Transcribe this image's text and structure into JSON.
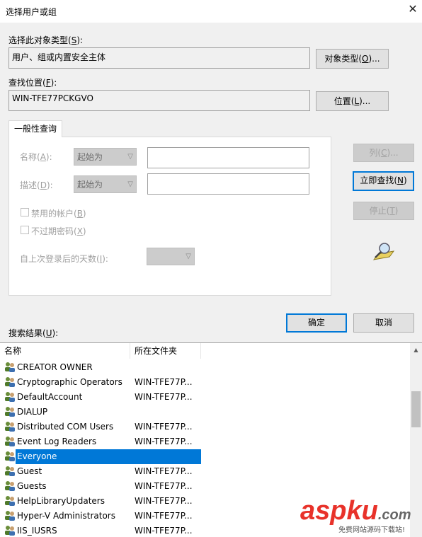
{
  "dialog": {
    "title": "选择用户或组"
  },
  "object_type": {
    "label_pre": "选择此对象类型(",
    "label_key": "S",
    "label_post": "):",
    "value": "用户、组或内置安全主体",
    "button_pre": "对象类型(",
    "button_key": "O",
    "button_post": ")..."
  },
  "location": {
    "label_pre": "查找位置(",
    "label_key": "F",
    "label_post": "):",
    "value": "WIN-TFE77PCKGVO",
    "button_pre": "位置(",
    "button_key": "L",
    "button_post": ")..."
  },
  "tab": {
    "label": "一般性查询"
  },
  "query": {
    "name_label_pre": "名称(",
    "name_label_key": "A",
    "name_label_post": "):",
    "name_combo": "起始为",
    "desc_label_pre": "描述(",
    "desc_label_key": "D",
    "desc_label_post": "):",
    "desc_combo": "起始为",
    "disabled_accounts_pre": "禁用的帐户(",
    "disabled_accounts_key": "B",
    "disabled_accounts_post": ")",
    "no_expire_pre": "不过期密码(",
    "no_expire_key": "X",
    "no_expire_post": ")",
    "days_label_pre": "自上次登录后的天数(",
    "days_label_key": "I",
    "days_label_post": "):"
  },
  "side_buttons": {
    "columns_pre": "列(",
    "columns_key": "C",
    "columns_post": ")...",
    "find_now_pre": "立即查找(",
    "find_now_key": "N",
    "find_now_post": ")",
    "stop_pre": "停止(",
    "stop_key": "T",
    "stop_post": ")"
  },
  "ok_label": "确定",
  "cancel_label": "取消",
  "results": {
    "label_pre": "搜索结果(",
    "label_key": "U",
    "label_post": "):",
    "col_name": "名称",
    "col_folder": "所在文件夹",
    "rows": [
      {
        "name": "CREATOR OWNER",
        "folder": ""
      },
      {
        "name": "Cryptographic Operators",
        "folder": "WIN-TFE77P..."
      },
      {
        "name": "DefaultAccount",
        "folder": "WIN-TFE77P..."
      },
      {
        "name": "DIALUP",
        "folder": ""
      },
      {
        "name": "Distributed COM Users",
        "folder": "WIN-TFE77P..."
      },
      {
        "name": "Event Log Readers",
        "folder": "WIN-TFE77P..."
      },
      {
        "name": "Everyone",
        "folder": ""
      },
      {
        "name": "Guest",
        "folder": "WIN-TFE77P..."
      },
      {
        "name": "Guests",
        "folder": "WIN-TFE77P..."
      },
      {
        "name": "HelpLibraryUpdaters",
        "folder": "WIN-TFE77P..."
      },
      {
        "name": "Hyper-V Administrators",
        "folder": "WIN-TFE77P..."
      },
      {
        "name": "IIS_IUSRS",
        "folder": "WIN-TFE77P..."
      }
    ],
    "selected_index": 6
  },
  "watermark": {
    "brand_a": "asp",
    "brand_b": "ku",
    "brand_c": ".com",
    "sub": "免费网站源码下载站!"
  },
  "colors": {
    "accent": "#0078d7",
    "wm_red": "#e8322a",
    "wm_gray": "#666666"
  }
}
